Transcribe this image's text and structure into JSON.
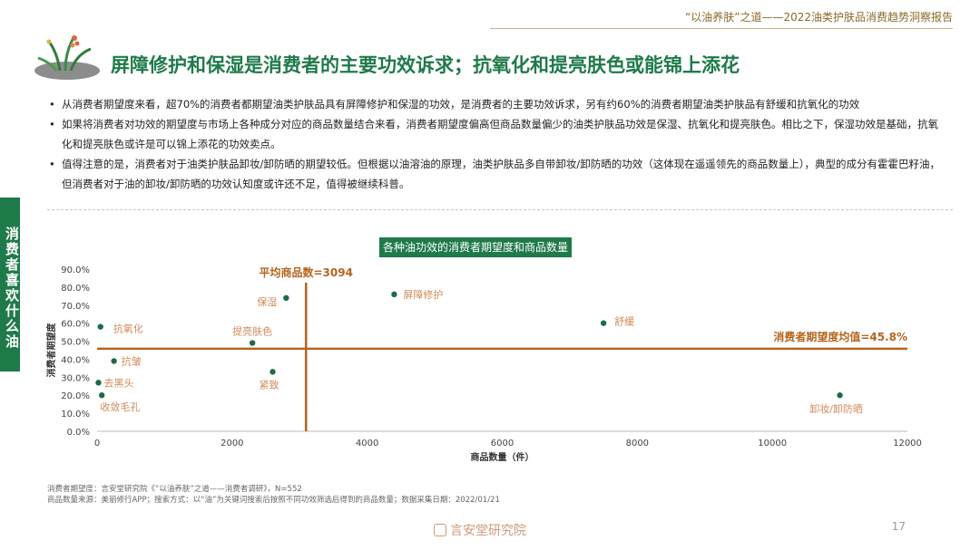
{
  "header": {
    "report_title": "“以油养肤”之道——2022油类护肤品消费趋势洞察报告",
    "headline": "屏障修护和保湿是消费者的主要功效诉求；抗氧化和提亮肤色或能锦上添花"
  },
  "bullets": [
    "从消费者期望度来看，超70%的消费者都期望油类护肤品具有屏障修护和保湿的功效，是消费者的主要功效诉求，另有约60%的消费者期望油类护肤品有舒缓和抗氧化的功效",
    "如果将消费者对功效的期望度与市场上各种成分对应的商品数量结合来看，消费者期望度偏高但商品数量偏少的油类护肤品功效是保湿、抗氧化和提亮肤色。相比之下，保湿功效是基础，抗氧化和提亮肤色或许是可以锦上添花的功效卖点。",
    "值得注意的是，消费者对于油类护肤品卸妆/卸防晒的期望较低。但根据以油溶油的原理，油类护肤品多自带卸妆/卸防晒的功效（这体现在遥遥领先的商品数量上），典型的成分有霍霍巴籽油，但消费者对于油的卸妆/卸防晒的功效认知度或许还不足，值得被继续科普。"
  ],
  "side_tab": "消费者喜欢什么油",
  "chart_data": {
    "type": "scatter",
    "title": "各种油功效的消费者期望度和商品数量",
    "xlabel": "商品数量（件）",
    "ylabel": "消费者期望度",
    "xlim": [
      0,
      12000
    ],
    "ylim": [
      0,
      0.9
    ],
    "xticks": [
      0,
      2000,
      4000,
      6000,
      8000,
      10000,
      12000
    ],
    "yticks": [
      "0.0%",
      "10.0%",
      "20.0%",
      "30.0%",
      "40.0%",
      "50.0%",
      "60.0%",
      "70.0%",
      "80.0%",
      "90.0%"
    ],
    "points": [
      {
        "label": "屏障修护",
        "x": 4400,
        "y": 0.76
      },
      {
        "label": "保湿",
        "x": 2800,
        "y": 0.74
      },
      {
        "label": "舒缓",
        "x": 7500,
        "y": 0.6
      },
      {
        "label": "抗氧化",
        "x": 50,
        "y": 0.58
      },
      {
        "label": "提亮肤色",
        "x": 2300,
        "y": 0.49
      },
      {
        "label": "抗皱",
        "x": 250,
        "y": 0.39
      },
      {
        "label": "紧致",
        "x": 2600,
        "y": 0.33
      },
      {
        "label": "去黑头",
        "x": 20,
        "y": 0.27
      },
      {
        "label": "收敛毛孔",
        "x": 70,
        "y": 0.2
      },
      {
        "label": "卸妆/卸防晒",
        "x": 11000,
        "y": 0.2
      }
    ],
    "reference_lines": {
      "vertical": {
        "value": 3094,
        "label": "平均商品数=3094"
      },
      "horizontal": {
        "value": 0.458,
        "label": "消费者期望度均值=45.8%"
      }
    },
    "colors": {
      "point": "#1e6b44",
      "reference_line": "#b5651d",
      "point_label": "#d08a5a"
    }
  },
  "footnotes": [
    "消费者期望度：言安堂研究院《“以油养肤”之道——消费者调研》，N=552",
    "商品数量来源：美丽修行APP；搜索方式：以“油”为关键词搜索后按照不同功效筛选后得到的商品数量；数据采集日期：2022/01/21"
  ],
  "footer": {
    "brand": "言安堂研究院",
    "page_number": "17"
  }
}
